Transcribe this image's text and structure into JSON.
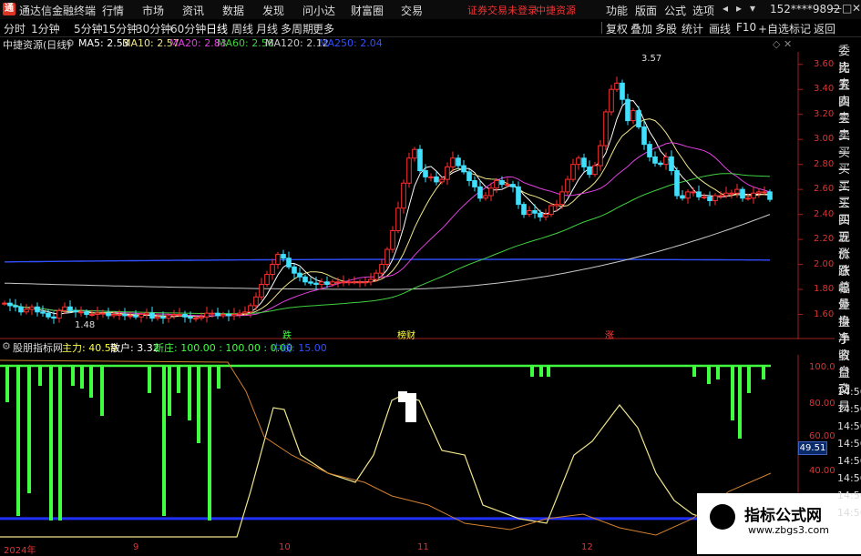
{
  "app": {
    "title": "通达信金融终端",
    "logo": "通"
  },
  "menu": [
    "行情",
    "市场",
    "资讯",
    "数据",
    "发现",
    "问小达",
    "财富圈",
    "交易"
  ],
  "warning": {
    "text": "证券交易未登录",
    "stock": "中捷资源"
  },
  "right_menu": [
    "功能",
    "版面",
    "公式",
    "选项"
  ],
  "account": "152****9892",
  "window_buttons": [
    "◂",
    "▸",
    "▾",
    "—",
    "□",
    "✕"
  ],
  "periods": [
    "分时",
    "1分钟",
    "5分钟",
    "15分钟",
    "30分钟",
    "60分钟",
    "日线",
    "周线",
    "月线",
    "多周期",
    "更多"
  ],
  "active_period": "日线",
  "toolbar": [
    "复权",
    "叠加",
    "多股",
    "统计",
    "画线",
    "F10",
    "+自选",
    "标记",
    "返回"
  ],
  "main_header": {
    "stock": "中捷资源(日线)",
    "ma": [
      {
        "label": "MA5: 2.53",
        "color": "#ffffff"
      },
      {
        "label": "MA10: 2.57",
        "color": "#f0e68c"
      },
      {
        "label": "MA20: 2.83",
        "color": "#e040e0"
      },
      {
        "label": "MA60: 2.58",
        "color": "#40d040"
      },
      {
        "label": "MA120: 2.12",
        "color": "#c8c8c8"
      },
      {
        "label": "MA250: 2.04",
        "color": "#3050ff"
      }
    ]
  },
  "sub_header": {
    "name": "股朋指标网",
    "items": [
      {
        "label": "主力: 40.59",
        "color": "#ffff40"
      },
      {
        "label": "散户: 3.32",
        "color": "#ffffff"
      },
      {
        "label": "新庄: 100.00 : 100.00 : 0.00",
        "color": "#40ff40"
      },
      {
        "label": "中线: 15.00",
        "color": "#3050ff"
      }
    ]
  },
  "y_axis_main": [
    "3.60",
    "3.40",
    "3.20",
    "3.00",
    "2.80",
    "2.60",
    "2.40",
    "2.20",
    "2.00",
    "1.80",
    "1.60"
  ],
  "y_axis_sub": [
    "100.0",
    "80.00",
    "60.00",
    "40.00",
    "20.00"
  ],
  "current_value": "49.51",
  "annotations": {
    "high": "3.57",
    "low": "1.48"
  },
  "events": [
    {
      "label": "跌",
      "color": "#40ff40"
    },
    {
      "label": "榜财",
      "color": "#ffff40"
    },
    {
      "label": "涨",
      "color": "#ff4040"
    }
  ],
  "x_axis": [
    "2024年",
    "9",
    "10",
    "11",
    "12"
  ],
  "right_panel": [
    "委比",
    "卖五",
    "卖四",
    "卖三",
    "卖二",
    "卖一",
    "买一",
    "买二",
    "买三",
    "买四",
    "买五",
    "现价",
    "涨跌",
    "涨幅",
    "总量",
    "外盘",
    "换手",
    "净资",
    "收益",
    "自动",
    "交易"
  ],
  "times": [
    "14:56",
    "14:56",
    "14:56",
    "14:56",
    "14:56",
    "14:56",
    "14:56",
    "14:56"
  ],
  "watermark": {
    "title": "指标公式网",
    "url": "www.zbgs3.com"
  },
  "chart_data": [
    {
      "type": "candlestick",
      "title": "中捷资源(日线)",
      "ylim": [
        1.48,
        3.6
      ],
      "x": [
        0,
        1,
        2,
        3,
        4,
        5,
        6,
        7,
        8,
        9,
        10,
        11,
        12,
        13,
        14,
        15,
        16,
        17,
        18,
        19,
        20,
        21,
        22,
        23,
        24,
        25,
        26,
        27,
        28,
        29,
        30,
        31,
        32,
        33,
        34,
        35,
        36,
        37,
        38,
        39,
        40,
        41,
        42,
        43,
        44,
        45,
        46,
        47,
        48,
        49,
        50,
        51,
        52,
        53,
        54,
        55,
        56,
        57,
        58,
        59,
        60,
        61,
        62,
        63,
        64,
        65,
        66,
        67,
        68,
        69,
        70,
        71,
        72,
        73,
        74,
        75,
        76,
        77,
        78,
        79,
        80,
        81,
        82,
        83,
        84,
        85,
        86,
        87,
        88,
        89,
        90,
        91,
        92,
        93,
        94,
        95,
        96,
        97,
        98,
        99,
        100,
        101,
        102,
        103,
        104,
        105,
        106,
        107,
        108,
        109,
        110,
        111,
        112,
        113,
        114,
        115,
        116,
        117,
        118,
        119,
        120,
        121,
        122,
        123,
        124,
        125,
        126,
        127,
        128,
        129,
        130,
        131,
        132,
        133,
        134,
        135,
        136,
        137,
        138,
        139,
        140
      ],
      "close": [
        1.69,
        1.67,
        1.66,
        1.62,
        1.64,
        1.66,
        1.62,
        1.61,
        1.58,
        1.57,
        1.63,
        1.66,
        1.63,
        1.62,
        1.62,
        1.6,
        1.6,
        1.61,
        1.61,
        1.59,
        1.6,
        1.6,
        1.59,
        1.59,
        1.58,
        1.6,
        1.61,
        1.57,
        1.58,
        1.57,
        1.59,
        1.6,
        1.6,
        1.58,
        1.57,
        1.57,
        1.58,
        1.61,
        1.61,
        1.59,
        1.6,
        1.59,
        1.6,
        1.61,
        1.62,
        1.67,
        1.74,
        1.84,
        1.92,
        2.0,
        2.08,
        2.05,
        1.98,
        1.93,
        1.9,
        1.86,
        1.85,
        1.84,
        1.86,
        1.84,
        1.86,
        1.86,
        1.86,
        1.86,
        1.86,
        1.86,
        1.86,
        1.88,
        1.93,
        2.0,
        2.12,
        2.27,
        2.45,
        2.65,
        2.85,
        2.92,
        2.75,
        2.7,
        2.7,
        2.66,
        2.68,
        2.78,
        2.85,
        2.79,
        2.74,
        2.67,
        2.62,
        2.53,
        2.55,
        2.61,
        2.67,
        2.64,
        2.64,
        2.62,
        2.48,
        2.4,
        2.43,
        2.41,
        2.38,
        2.4,
        2.47,
        2.48,
        2.58,
        2.68,
        2.8,
        2.85,
        2.78,
        2.72,
        2.79,
        2.95,
        3.22,
        3.4,
        3.45,
        3.32,
        3.15,
        3.23,
        3.1,
        2.96,
        2.86,
        2.81,
        2.8,
        2.86,
        2.75,
        2.55,
        2.53,
        2.58,
        2.58,
        2.54,
        2.54,
        2.51,
        2.55,
        2.55,
        2.57,
        2.57,
        2.6,
        2.53,
        2.53,
        2.57,
        2.58,
        2.58,
        2.52
      ]
    },
    {
      "type": "bar+line",
      "title": "股朋指标网",
      "ylim": [
        0,
        110
      ],
      "series": [
        {
          "name": "主力",
          "values": [
            40.59
          ]
        },
        {
          "name": "散户",
          "values": [
            3.32
          ]
        },
        {
          "name": "新庄",
          "values": [
            100.0,
            100.0,
            0.0
          ]
        },
        {
          "name": "中线",
          "values": [
            15.0
          ]
        }
      ]
    }
  ]
}
